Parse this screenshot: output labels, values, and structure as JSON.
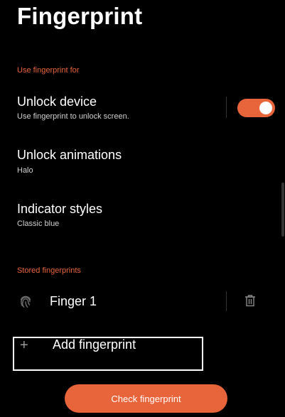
{
  "header": {
    "title": "Fingerprint"
  },
  "use_section": {
    "label": "Use fingerprint for",
    "unlock_device": {
      "title": "Unlock device",
      "subtitle": "Use fingerprint to unlock screen.",
      "toggle_on": true
    },
    "unlock_animations": {
      "title": "Unlock animations",
      "value": "Halo"
    },
    "indicator_styles": {
      "title": "Indicator styles",
      "value": "Classic blue"
    }
  },
  "stored_section": {
    "label": "Stored fingerprints",
    "fingers": [
      {
        "name": "Finger 1"
      }
    ],
    "add_label": "Add fingerprint"
  },
  "check_button": {
    "label": "Check fingerprint"
  },
  "colors": {
    "accent": "#e8643a",
    "background": "#000000"
  }
}
